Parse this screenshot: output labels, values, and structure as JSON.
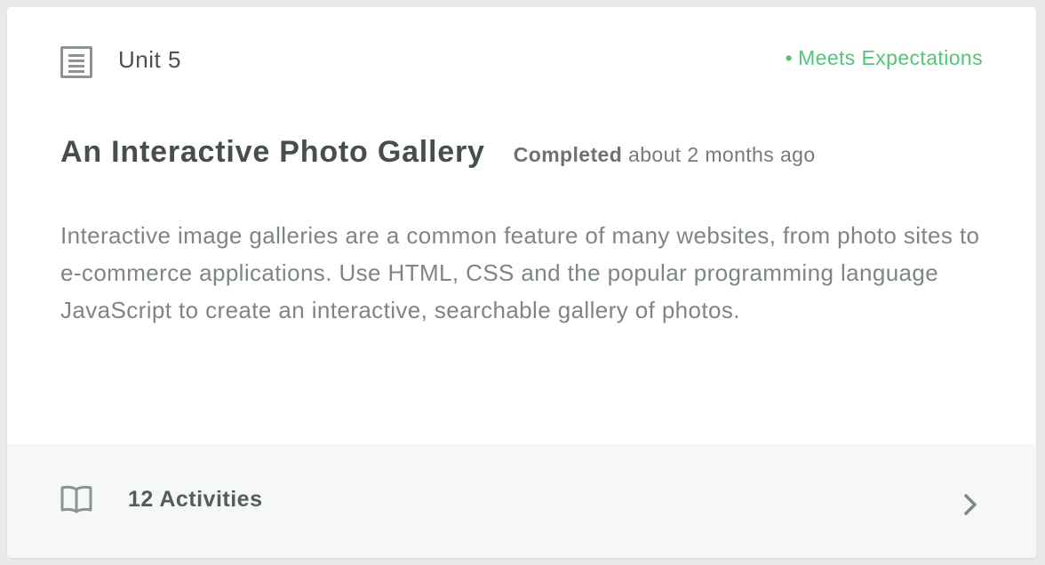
{
  "unit": {
    "icon": "document-list-icon",
    "label": "Unit 5"
  },
  "status": {
    "dot": "•",
    "label": "Meets Expectations",
    "color": "#53c479"
  },
  "lesson": {
    "title": "An Interactive Photo Gallery",
    "completed_label": "Completed",
    "completed_time": "about 2 months ago",
    "description": "Interactive image galleries are a common feature of many websites, from photo sites to e-commerce applications. Use HTML, CSS and the popular programming language JavaScript to create an interactive, searchable gallery of photos."
  },
  "footer": {
    "icon": "book-icon",
    "activities_label": "12 Activities",
    "chevron_icon": "chevron-right-icon"
  }
}
